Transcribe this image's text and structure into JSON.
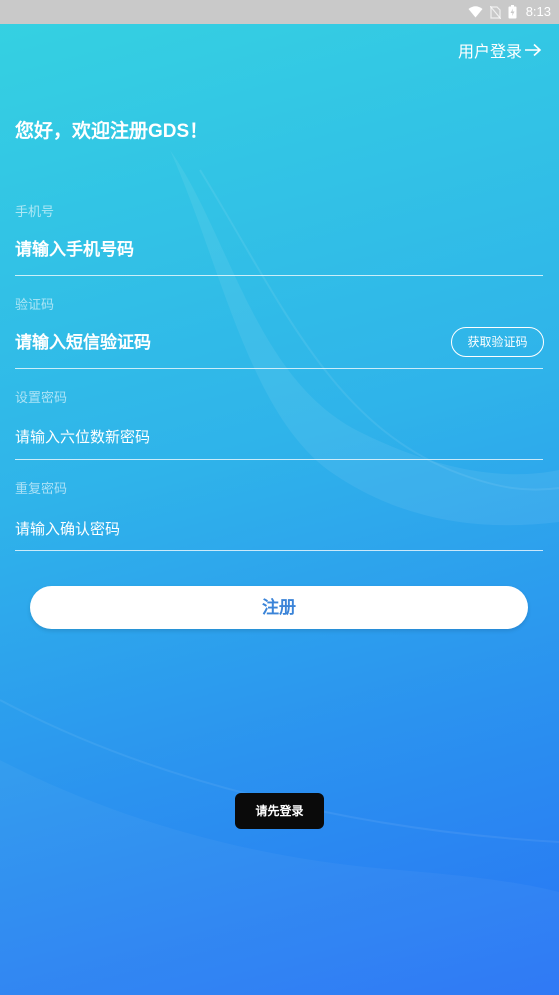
{
  "status_bar": {
    "time": "8:13",
    "icons": [
      "wifi-icon",
      "no-sim-icon",
      "battery-charging-icon"
    ]
  },
  "header": {
    "login_link": "用户登录",
    "login_icon": "arrow-right-icon"
  },
  "title": "您好，欢迎注册GDS！",
  "form": {
    "phone": {
      "label": "手机号",
      "placeholder": "请输入手机号码"
    },
    "code": {
      "label": "验证码",
      "placeholder": "请输入短信验证码",
      "get_code_button": "获取验证码"
    },
    "password": {
      "label": "设置密码",
      "placeholder": "请输入六位数新密码"
    },
    "confirm_password": {
      "label": "重复密码",
      "placeholder": "请输入确认密码"
    }
  },
  "register_button": "注册",
  "toast": "请先登录",
  "colors": {
    "gradient_top": "#35d2e1",
    "gradient_bottom": "#2874f5",
    "status_bar": "#c9c9c9",
    "accent": "#3b84d8",
    "toast_bg": "#0a0a0a"
  }
}
